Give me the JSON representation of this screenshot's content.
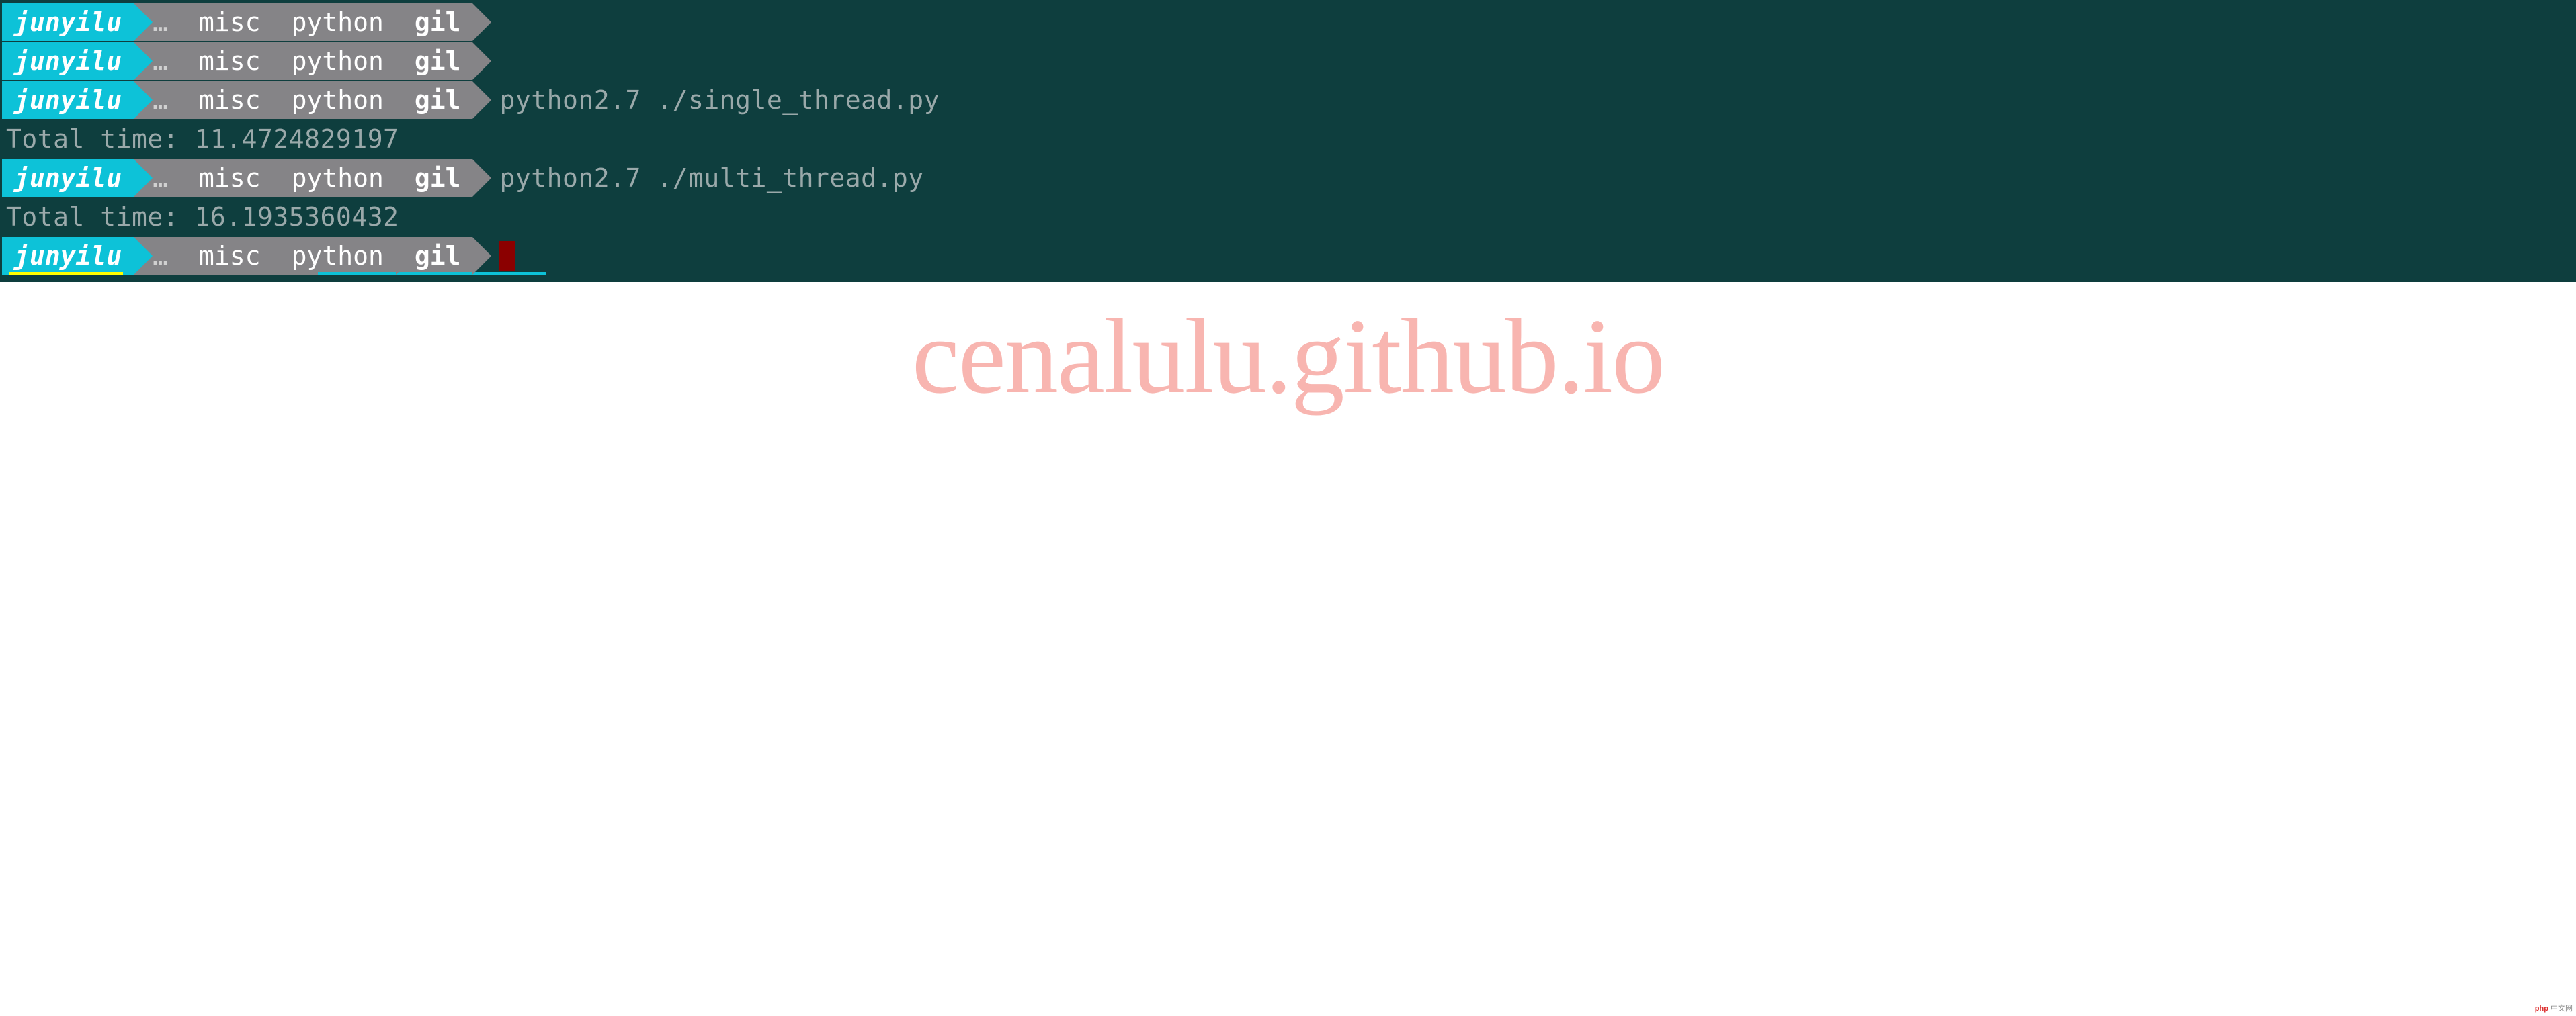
{
  "prompt": {
    "user": "junyilu",
    "dots": "…",
    "seg1": "misc",
    "seg2": "python",
    "seg3": "gil"
  },
  "lines": [
    {
      "kind": "prompt"
    },
    {
      "kind": "prompt"
    },
    {
      "kind": "prompt_cmd",
      "command": "python2.7 ./single_thread.py"
    },
    {
      "kind": "output",
      "text": "Total time: 11.4724829197"
    },
    {
      "kind": "prompt_cmd",
      "command": "python2.7 ./multi_thread.py"
    },
    {
      "kind": "output",
      "text": "Total time: 16.1935360432"
    },
    {
      "kind": "prompt_cursor"
    }
  ],
  "watermark": "cenalulu.github.io",
  "footer": "中文网"
}
